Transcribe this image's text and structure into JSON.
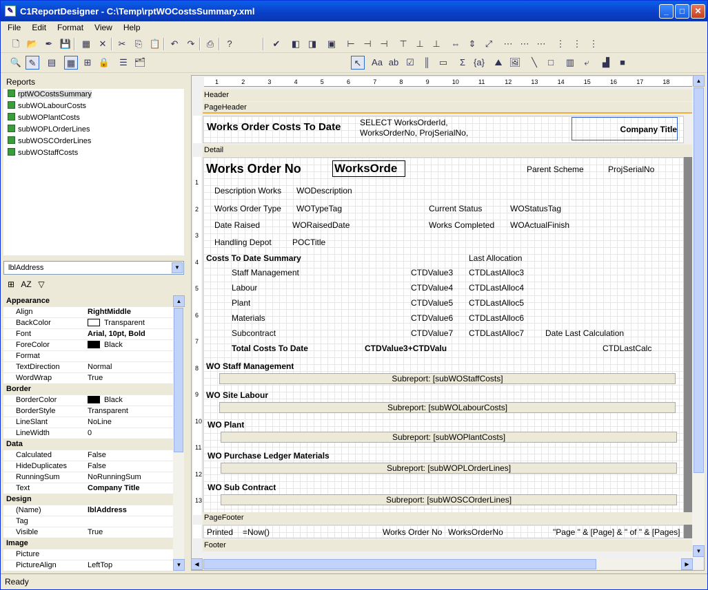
{
  "window": {
    "title": "C1ReportDesigner - C:\\Temp\\rptWOCostsSummary.xml",
    "minimize": "_",
    "maximize": "□",
    "close": "✕"
  },
  "menu": [
    "File",
    "Edit",
    "Format",
    "View",
    "Help"
  ],
  "reports_header": "Reports",
  "reports": [
    {
      "name": "rptWOCostsSummary",
      "selected": true
    },
    {
      "name": "subWOLabourCosts"
    },
    {
      "name": "subWOPlantCosts"
    },
    {
      "name": "subWOPLOrderLines"
    },
    {
      "name": "subWOSCOrderLines"
    },
    {
      "name": "subWOStaffCosts"
    }
  ],
  "object_combo": "lblAddress",
  "properties": [
    {
      "cat": "Appearance"
    },
    {
      "k": "Align",
      "v": "RightMiddle",
      "bold": true
    },
    {
      "k": "BackColor",
      "v": "Transparent",
      "swatch": "#ffffff"
    },
    {
      "k": "Font",
      "v": "Arial, 10pt, Bold",
      "bold": true,
      "exp": true
    },
    {
      "k": "ForeColor",
      "v": "Black",
      "swatch": "#000000"
    },
    {
      "k": "Format",
      "v": ""
    },
    {
      "k": "TextDirection",
      "v": "Normal"
    },
    {
      "k": "WordWrap",
      "v": "True"
    },
    {
      "cat": "Border"
    },
    {
      "k": "BorderColor",
      "v": "Black",
      "swatch": "#000000"
    },
    {
      "k": "BorderStyle",
      "v": "Transparent"
    },
    {
      "k": "LineSlant",
      "v": "NoLine"
    },
    {
      "k": "LineWidth",
      "v": "0"
    },
    {
      "cat": "Data"
    },
    {
      "k": "Calculated",
      "v": "False"
    },
    {
      "k": "HideDuplicates",
      "v": "False"
    },
    {
      "k": "RunningSum",
      "v": "NoRunningSum"
    },
    {
      "k": "Text",
      "v": "Company Title",
      "bold": true
    },
    {
      "cat": "Design"
    },
    {
      "k": "(Name)",
      "v": "lblAddress",
      "bold": true
    },
    {
      "k": "Tag",
      "v": ""
    },
    {
      "k": "Visible",
      "v": "True"
    },
    {
      "cat": "Image"
    },
    {
      "k": "Picture",
      "v": ""
    },
    {
      "k": "PictureAlign",
      "v": "LeftTop"
    }
  ],
  "ruler": [
    "1",
    "2",
    "3",
    "4",
    "5",
    "6",
    "7",
    "8",
    "9",
    "10",
    "11",
    "12",
    "13",
    "14",
    "15",
    "16",
    "17",
    "18"
  ],
  "sections": {
    "header": "Header",
    "page_header": "PageHeader",
    "detail": "Detail",
    "page_footer": "PageFooter",
    "footer": "Footer"
  },
  "page_header_fields": {
    "title": "Works Order Costs To Date",
    "sql": "SELECT WorksOrderId, WorksOrderNo, ProjSerialNo,",
    "company": "Company Title"
  },
  "detail_fields": {
    "wo_label": "Works Order No",
    "wo_value": "WorksOrde",
    "parent_scheme": "Parent Scheme",
    "proj_serial": "ProjSerialNo",
    "desc_label": "Description Works",
    "desc_value": "WODescription",
    "type_label": "Works Order Type",
    "type_value": "WOTypeTag",
    "status_label": "Current Status",
    "status_value": "WOStatusTag",
    "raised_label": "Date Raised",
    "raised_value": "WORaisedDate",
    "completed_label": "Works Completed",
    "completed_value": "WOActualFinish",
    "depot_label": "Handling Depot",
    "depot_value": "POCTitle",
    "summary": "Costs To Date Summary",
    "last_alloc": "Last Allocation",
    "rows": [
      {
        "label": "Staff Management",
        "value": "CTDValue3",
        "alloc": "CTDLastAlloc3"
      },
      {
        "label": "Labour",
        "value": "CTDValue4",
        "alloc": "CTDLastAlloc4"
      },
      {
        "label": "Plant",
        "value": "CTDValue5",
        "alloc": "CTDLastAlloc5"
      },
      {
        "label": "Materials",
        "value": "CTDValue6",
        "alloc": "CTDLastAlloc6"
      },
      {
        "label": "Subcontract",
        "value": "CTDValue7",
        "alloc": "CTDLastAlloc7"
      }
    ],
    "date_last_calc": "Date Last Calculation",
    "total_label": "Total Costs To Date",
    "total_value": "CTDValue3+CTDValu",
    "last_calc": "CTDLastCalc",
    "subreports": [
      {
        "title": "WO Staff Management",
        "sub": "Subreport: [subWOStaffCosts]"
      },
      {
        "title": "WO Site Labour",
        "sub": "Subreport: [subWOLabourCosts]"
      },
      {
        "title": "WO Plant",
        "sub": "Subreport: [subWOPlantCosts]"
      },
      {
        "title": "WO Purchase Ledger Materials",
        "sub": "Subreport: [subWOPLOrderLines]"
      },
      {
        "title": "WO Sub Contract",
        "sub": "Subreport: [subWOSCOrderLines]"
      }
    ]
  },
  "vruler": [
    "1",
    "2",
    "3",
    "4",
    "5",
    "6",
    "7",
    "8",
    "9",
    "10",
    "11",
    "12",
    "13"
  ],
  "footer_fields": {
    "printed": "Printed",
    "now": "=Now()",
    "wo_label": "Works Order No",
    "wo_value": "WorksOrderNo",
    "page": "\"Page \" & [Page] & \" of \" & [Pages]"
  },
  "status": "Ready"
}
